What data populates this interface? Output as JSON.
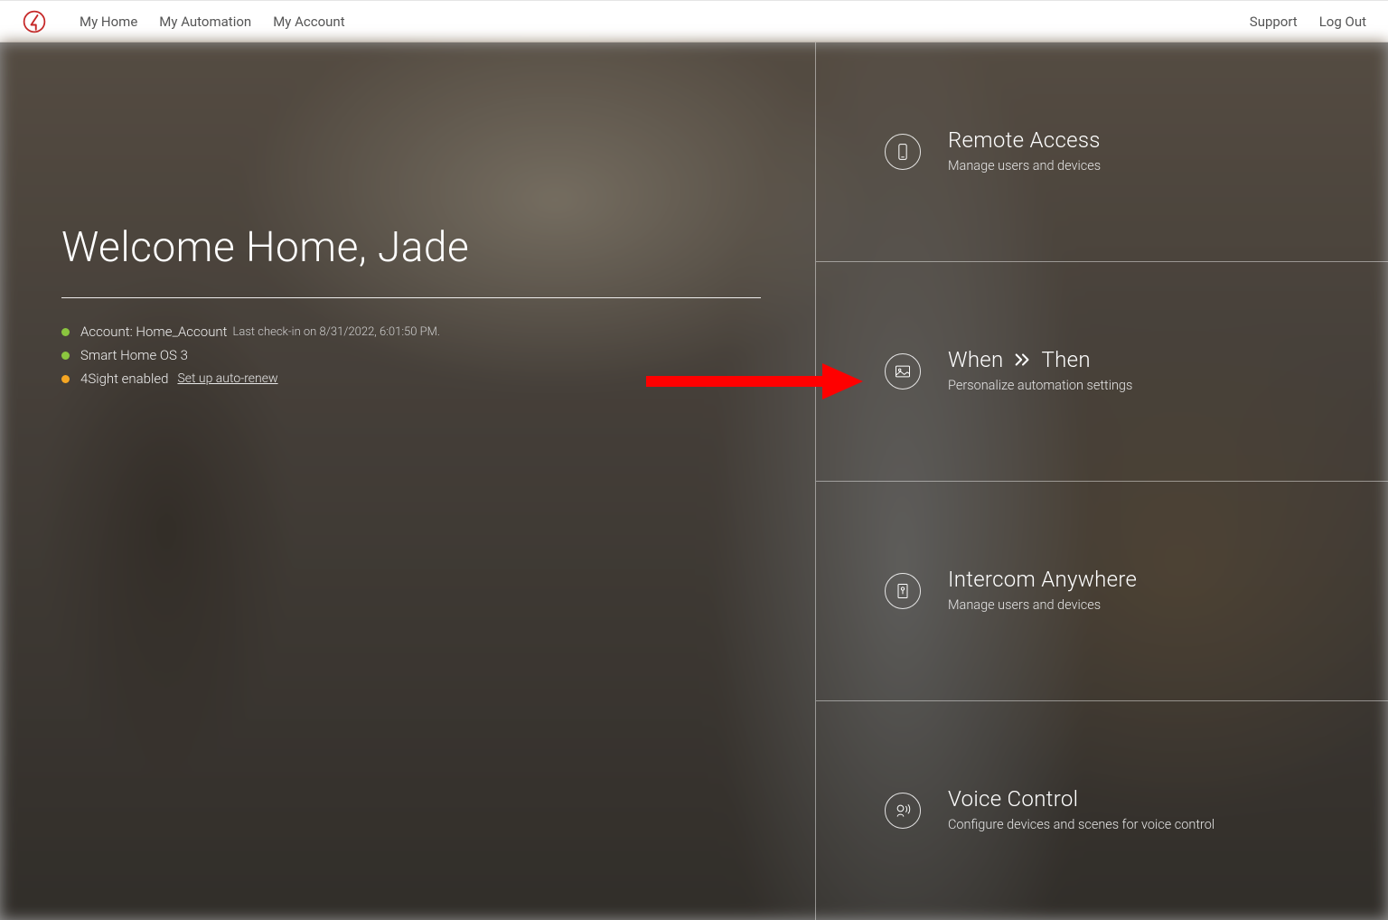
{
  "nav": {
    "left": [
      "My Home",
      "My Automation",
      "My Account"
    ],
    "right": [
      "Support",
      "Log Out"
    ]
  },
  "welcome": {
    "title": "Welcome Home, Jade",
    "items": [
      {
        "dot": "green",
        "label": "Account: Home_Account",
        "sub": "Last check-in on 8/31/2022, 6:01:50 PM.",
        "link": ""
      },
      {
        "dot": "green",
        "label": "Smart Home OS 3",
        "sub": "",
        "link": ""
      },
      {
        "dot": "orange",
        "label": "4Sight enabled",
        "sub": "",
        "link": "Set up auto-renew"
      }
    ]
  },
  "cards": [
    {
      "icon": "phone",
      "title_pre": "Remote Access",
      "title_post": "",
      "sub": "Manage users and devices"
    },
    {
      "icon": "picture",
      "title_pre": "When",
      "title_post": "Then",
      "sub": "Personalize automation settings"
    },
    {
      "icon": "door",
      "title_pre": "Intercom Anywhere",
      "title_post": "",
      "sub": "Manage users and devices"
    },
    {
      "icon": "voice",
      "title_pre": "Voice Control",
      "title_post": "",
      "sub": "Configure devices and scenes for voice control"
    }
  ]
}
